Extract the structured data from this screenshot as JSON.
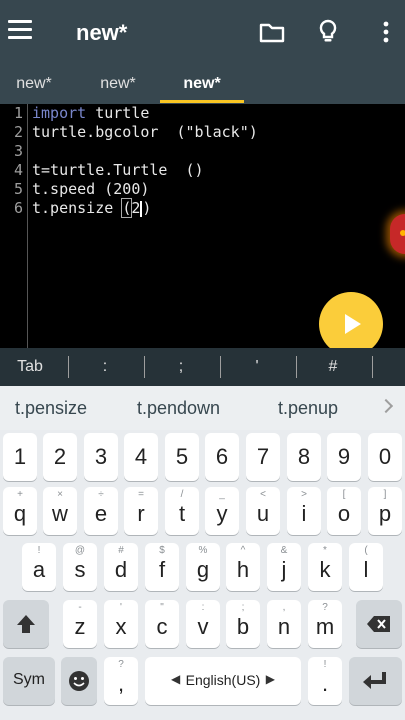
{
  "appbar": {
    "title": "new*"
  },
  "tabs": [
    {
      "label": "new*"
    },
    {
      "label": "new*"
    },
    {
      "label": "new*"
    }
  ],
  "editor": {
    "line_numbers": [
      "1",
      "2",
      "3",
      "4",
      "5",
      "6"
    ],
    "lines": [
      {
        "keyword": "import",
        "rest": " turtle"
      },
      {
        "text": "turtle.bgcolor  (\"black\")"
      },
      {
        "text": ""
      },
      {
        "text": "t=turtle.Turtle  ()"
      },
      {
        "text": "t.speed (200)"
      },
      {
        "pre": "t.pensize ",
        "bracket": "(",
        "post": "2",
        "tail": ")"
      }
    ]
  },
  "symbols": [
    "Tab",
    ":",
    ";",
    "'",
    "#"
  ],
  "suggestions": [
    "t.pensize",
    "t.pendown",
    "t.penup"
  ],
  "keyboard": {
    "numbers": [
      "1",
      "2",
      "3",
      "4",
      "5",
      "6",
      "7",
      "8",
      "9",
      "0"
    ],
    "row1": [
      {
        "k": "q",
        "s": "+"
      },
      {
        "k": "w",
        "s": "×"
      },
      {
        "k": "e",
        "s": "÷"
      },
      {
        "k": "r",
        "s": "="
      },
      {
        "k": "t",
        "s": "/"
      },
      {
        "k": "y",
        "s": "_"
      },
      {
        "k": "u",
        "s": "<"
      },
      {
        "k": "i",
        "s": ">"
      },
      {
        "k": "o",
        "s": "["
      },
      {
        "k": "p",
        "s": "]"
      }
    ],
    "row2": [
      {
        "k": "a",
        "s": "!"
      },
      {
        "k": "s",
        "s": "@"
      },
      {
        "k": "d",
        "s": "#"
      },
      {
        "k": "f",
        "s": "$"
      },
      {
        "k": "g",
        "s": "%"
      },
      {
        "k": "h",
        "s": "^"
      },
      {
        "k": "j",
        "s": "&"
      },
      {
        "k": "k",
        "s": "*"
      },
      {
        "k": "l",
        "s": "("
      }
    ],
    "row3": [
      {
        "k": "z",
        "s": "-"
      },
      {
        "k": "x",
        "s": "'"
      },
      {
        "k": "c",
        "s": "\""
      },
      {
        "k": "v",
        "s": ":"
      },
      {
        "k": "b",
        "s": ";"
      },
      {
        "k": "n",
        "s": ","
      },
      {
        "k": "m",
        "s": "?"
      }
    ],
    "sym_label": "Sym",
    "comma": ",",
    "comma_sub": "?",
    "space_label": "English(US)",
    "period": ".",
    "period_sub": "!",
    "row2_extra_sub": ")"
  },
  "colors": {
    "appbar": "#37474f",
    "accent": "#f9c623",
    "fab": "#fbcd3a",
    "keyword": "#7986cb"
  }
}
